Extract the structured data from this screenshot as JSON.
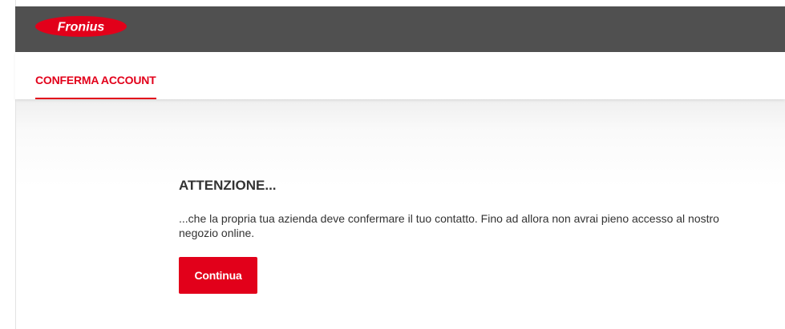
{
  "header": {
    "logo_text": "Fronius",
    "logo_icon": "fronius-logo",
    "background_color": "#505050",
    "accent_color": "#e2001a"
  },
  "tabs": [
    {
      "label": "CONFERMA ACCOUNT",
      "active": true
    }
  ],
  "main": {
    "heading": "ATTENZIONE...",
    "message": "...che la propria tua azienda deve confermare il tuo contatto. Fino ad allora non avrai pieno accesso al nostro negozio online.",
    "continue_label": "Continua"
  }
}
